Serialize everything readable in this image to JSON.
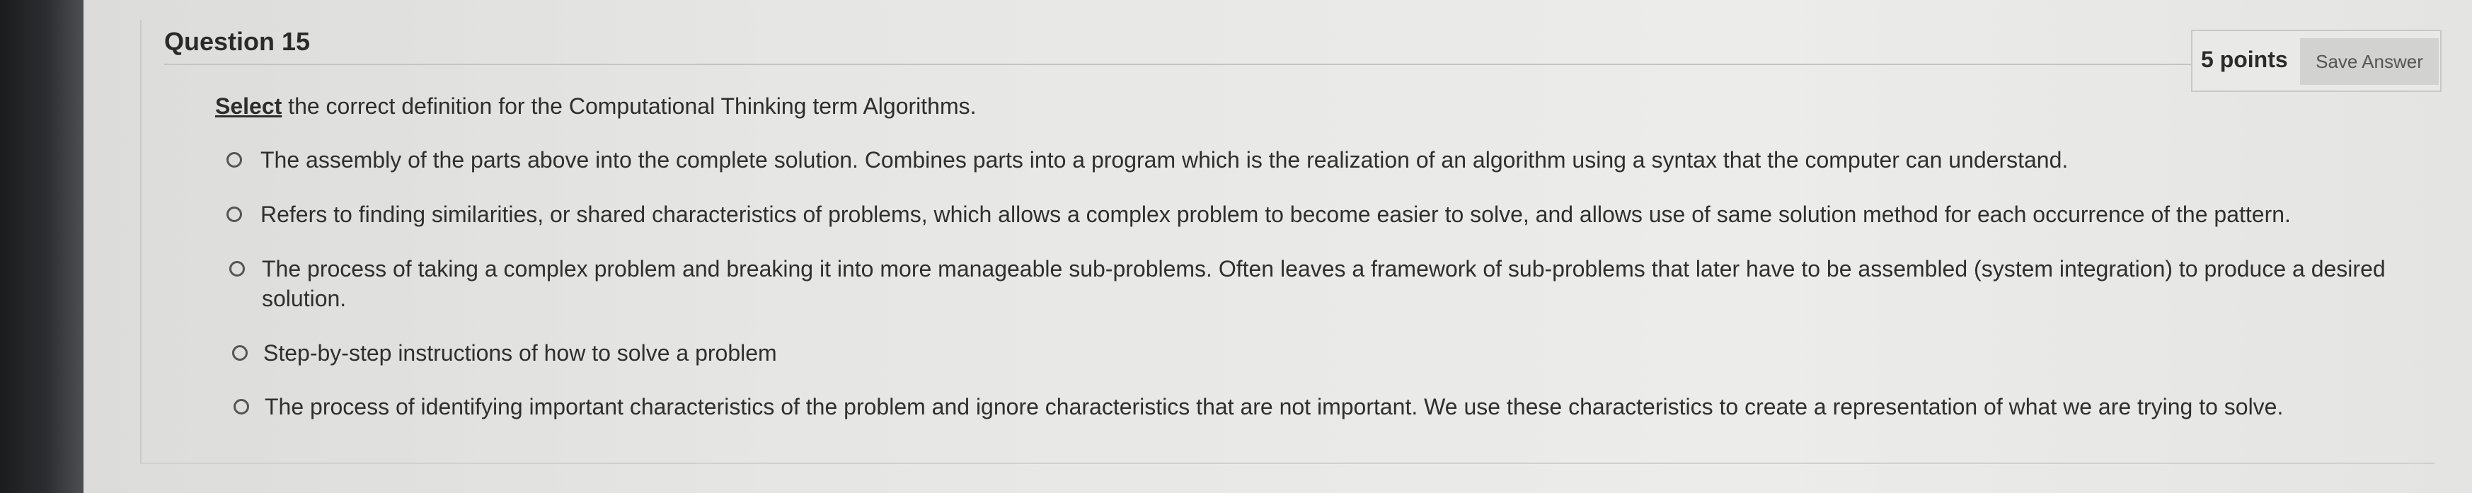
{
  "question": {
    "title": "Question 15",
    "points": "5 points",
    "save_label": "Save Answer",
    "prompt_emphasis": "Select",
    "prompt_rest": " the correct definition for the Computational Thinking term Algorithms."
  },
  "options": [
    {
      "text": "The assembly of the parts above into the complete solution. Combines parts into a program which is the realization of an algorithm using a syntax that the computer can understand.",
      "selected": false
    },
    {
      "text": "Refers to finding similarities, or shared characteristics of problems, which allows a complex problem to become easier to solve, and allows use of same solution method for each occurrence of the pattern.",
      "selected": false
    },
    {
      "text": "The process of taking a complex problem and breaking it into more manageable sub-problems. Often leaves a framework of sub-problems that later have to be assembled (system integration) to produce a desired solution.",
      "selected": false
    },
    {
      "text": "Step-by-step instructions of how to solve a problem",
      "selected": false
    },
    {
      "text": "The process of identifying important characteristics of the problem and ignore characteristics that are not important. We use these characteristics to create a representation of what we are trying to solve.",
      "selected": false
    }
  ]
}
